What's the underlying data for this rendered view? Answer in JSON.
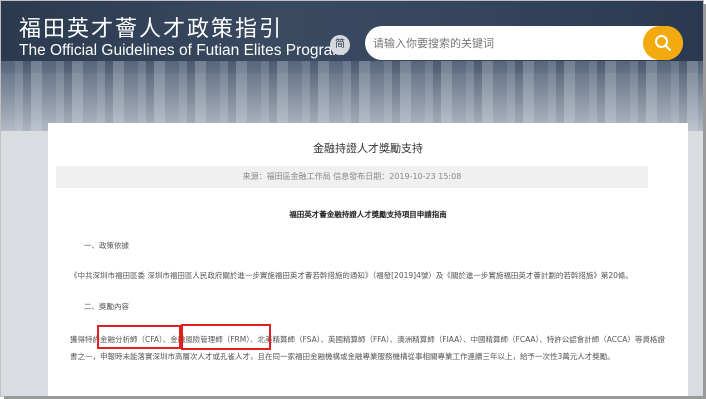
{
  "header": {
    "title_cn": "福田英才薈人才政策指引",
    "title_en": "The Official Guidelines of Futian Elites Program",
    "lang_toggle": "简",
    "search_placeholder": "请输入你要搜索的关键词"
  },
  "article": {
    "title": "金融持證人才獎勵支持",
    "meta": "来源：福田區金融工作局   信息發布日期：2019-10-23 15:08",
    "subtitle": "福田英才薈金融持證人才獎勵支持項目申請指南",
    "section1": "一、政策依據",
    "para1": "《中共深圳市福田區委 深圳市福田區人民政府關於進一步實施福田英才薈若幹措施的通知》（福發[2019]4號）及《關於進一步實施福田英才薈計劃的若幹措施》第20條。",
    "section2": "二、獎勵內容",
    "para2": "獲得特許金融分析師（CFA）、金融風險管理師（FRM）、北美精算師（FSA）、英國精算師（FFA）、澳洲精算師（FIAA）、中國精算師（FCAA）、特許公認會計師（ACCA）等資格證書之一，申報時未能落實深圳市高層次人才或孔雀人才，且在同一家福田金融機構或金融專業服務機構從事相關專業工作連續三年以上，給予一次性3萬元人才獎勵。"
  },
  "colors": {
    "search_button": "#f3aa0e",
    "highlight": "#e02020"
  },
  "icons": {
    "search": "magnifier-icon"
  }
}
